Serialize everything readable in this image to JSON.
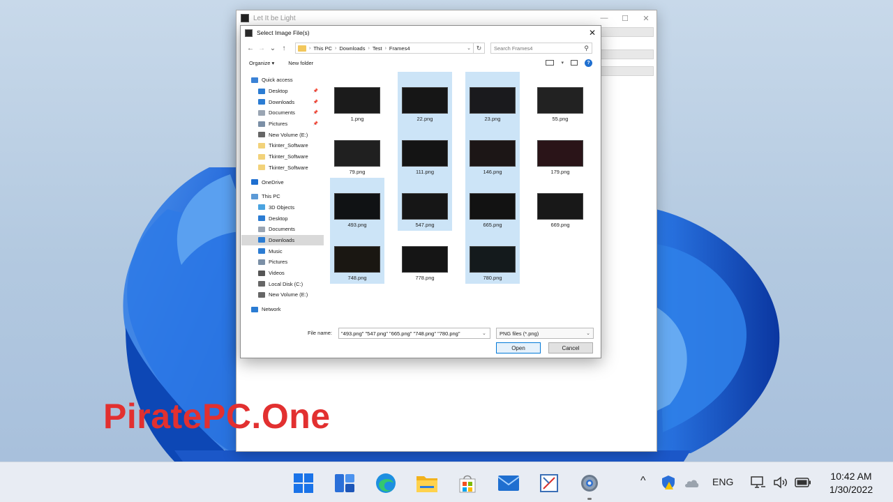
{
  "bg_window": {
    "title": "Let It be Light",
    "minimize": "—",
    "maximize": "☐",
    "close": "✕"
  },
  "dialog": {
    "title": "Select Image File(s)",
    "close": "✕",
    "nav": {
      "back": "←",
      "forward": "→",
      "recent": "⌄",
      "up": "↑"
    },
    "breadcrumb": [
      "This PC",
      "Downloads",
      "Test",
      "Frames4"
    ],
    "breadcrumb_sep": "›",
    "search_placeholder": "Search Frames4",
    "toolbar": {
      "organize": "Organize ▾",
      "new_folder": "New folder"
    },
    "nav_pane": [
      {
        "label": "Quick access",
        "level": 0,
        "icon": "star-icon",
        "color": "#3b82d6"
      },
      {
        "label": "Desktop",
        "level": 1,
        "icon": "desktop-icon",
        "color": "#2b7cd3",
        "pin": true
      },
      {
        "label": "Downloads",
        "level": 1,
        "icon": "download-icon",
        "color": "#2b7cd3",
        "pin": true
      },
      {
        "label": "Documents",
        "level": 1,
        "icon": "document-icon",
        "color": "#9aa5b3",
        "pin": true
      },
      {
        "label": "Pictures",
        "level": 1,
        "icon": "pictures-icon",
        "color": "#7b8fa6",
        "pin": true
      },
      {
        "label": "New Volume (E:)",
        "level": 1,
        "icon": "drive-icon",
        "color": "#666666"
      },
      {
        "label": "Tkinter_Software",
        "level": 1,
        "icon": "folder-icon",
        "color": "#f2d27a"
      },
      {
        "label": "Tkinter_Software",
        "level": 1,
        "icon": "folder-icon",
        "color": "#f2d27a"
      },
      {
        "label": "Tkinter_Software",
        "level": 1,
        "icon": "folder-icon",
        "color": "#f2d27a"
      },
      {
        "gap": true
      },
      {
        "label": "OneDrive",
        "level": 0,
        "icon": "cloud-icon",
        "color": "#1e6fd0"
      },
      {
        "gap": true
      },
      {
        "label": "This PC",
        "level": 0,
        "icon": "computer-icon",
        "color": "#5c9ad6"
      },
      {
        "label": "3D Objects",
        "level": 1,
        "icon": "cube-icon",
        "color": "#4aa3e0"
      },
      {
        "label": "Desktop",
        "level": 1,
        "icon": "desktop-icon",
        "color": "#2b7cd3"
      },
      {
        "label": "Documents",
        "level": 1,
        "icon": "document-icon",
        "color": "#9aa5b3"
      },
      {
        "label": "Downloads",
        "level": 1,
        "icon": "download-icon",
        "color": "#2b7cd3",
        "selected": true
      },
      {
        "label": "Music",
        "level": 1,
        "icon": "music-icon",
        "color": "#2b7cd3"
      },
      {
        "label": "Pictures",
        "level": 1,
        "icon": "pictures-icon",
        "color": "#7b8fa6"
      },
      {
        "label": "Videos",
        "level": 1,
        "icon": "video-icon",
        "color": "#555555"
      },
      {
        "label": "Local Disk (C:)",
        "level": 1,
        "icon": "drive-icon",
        "color": "#666666"
      },
      {
        "label": "New Volume (E:)",
        "level": 1,
        "icon": "drive-icon",
        "color": "#666666"
      },
      {
        "gap": true
      },
      {
        "label": "Network",
        "level": 0,
        "icon": "network-icon",
        "color": "#2b7cd3"
      }
    ],
    "files": [
      {
        "name": "1.png",
        "selected": false
      },
      {
        "name": "22.png",
        "selected": true
      },
      {
        "name": "23.png",
        "selected": true
      },
      {
        "name": "55.png",
        "selected": false
      },
      {
        "name": "79.png",
        "selected": false
      },
      {
        "name": "111.png",
        "selected": true
      },
      {
        "name": "146.png",
        "selected": true
      },
      {
        "name": "179.png",
        "selected": false
      },
      {
        "name": "493.png",
        "selected": true
      },
      {
        "name": "547.png",
        "selected": true
      },
      {
        "name": "665.png",
        "selected": true
      },
      {
        "name": "669.png",
        "selected": false
      },
      {
        "name": "748.png",
        "selected": true
      },
      {
        "name": "778.png",
        "selected": false
      },
      {
        "name": "780.png",
        "selected": true
      }
    ],
    "file_name_label": "File name:",
    "file_name_value": "\"493.png\" \"547.png\" \"665.png\" \"748.png\" \"780.png\"",
    "file_type": "PNG files (*.png)",
    "open_label": "Open",
    "cancel_label": "Cancel"
  },
  "watermark": "PiratePC.One",
  "taskbar": {
    "apps": [
      "windows-start-icon",
      "widgets-icon",
      "edge-icon",
      "file-explorer-icon",
      "store-icon",
      "mail-icon",
      "snipping-icon",
      "settings-icon"
    ],
    "tray": {
      "chevron": "^",
      "language": "ENG"
    },
    "time": "10:42 AM",
    "date": "1/30/2022"
  },
  "colors": {
    "accent": "#0078d7",
    "selection": "#cce4f7",
    "watermark": "#e23030"
  }
}
